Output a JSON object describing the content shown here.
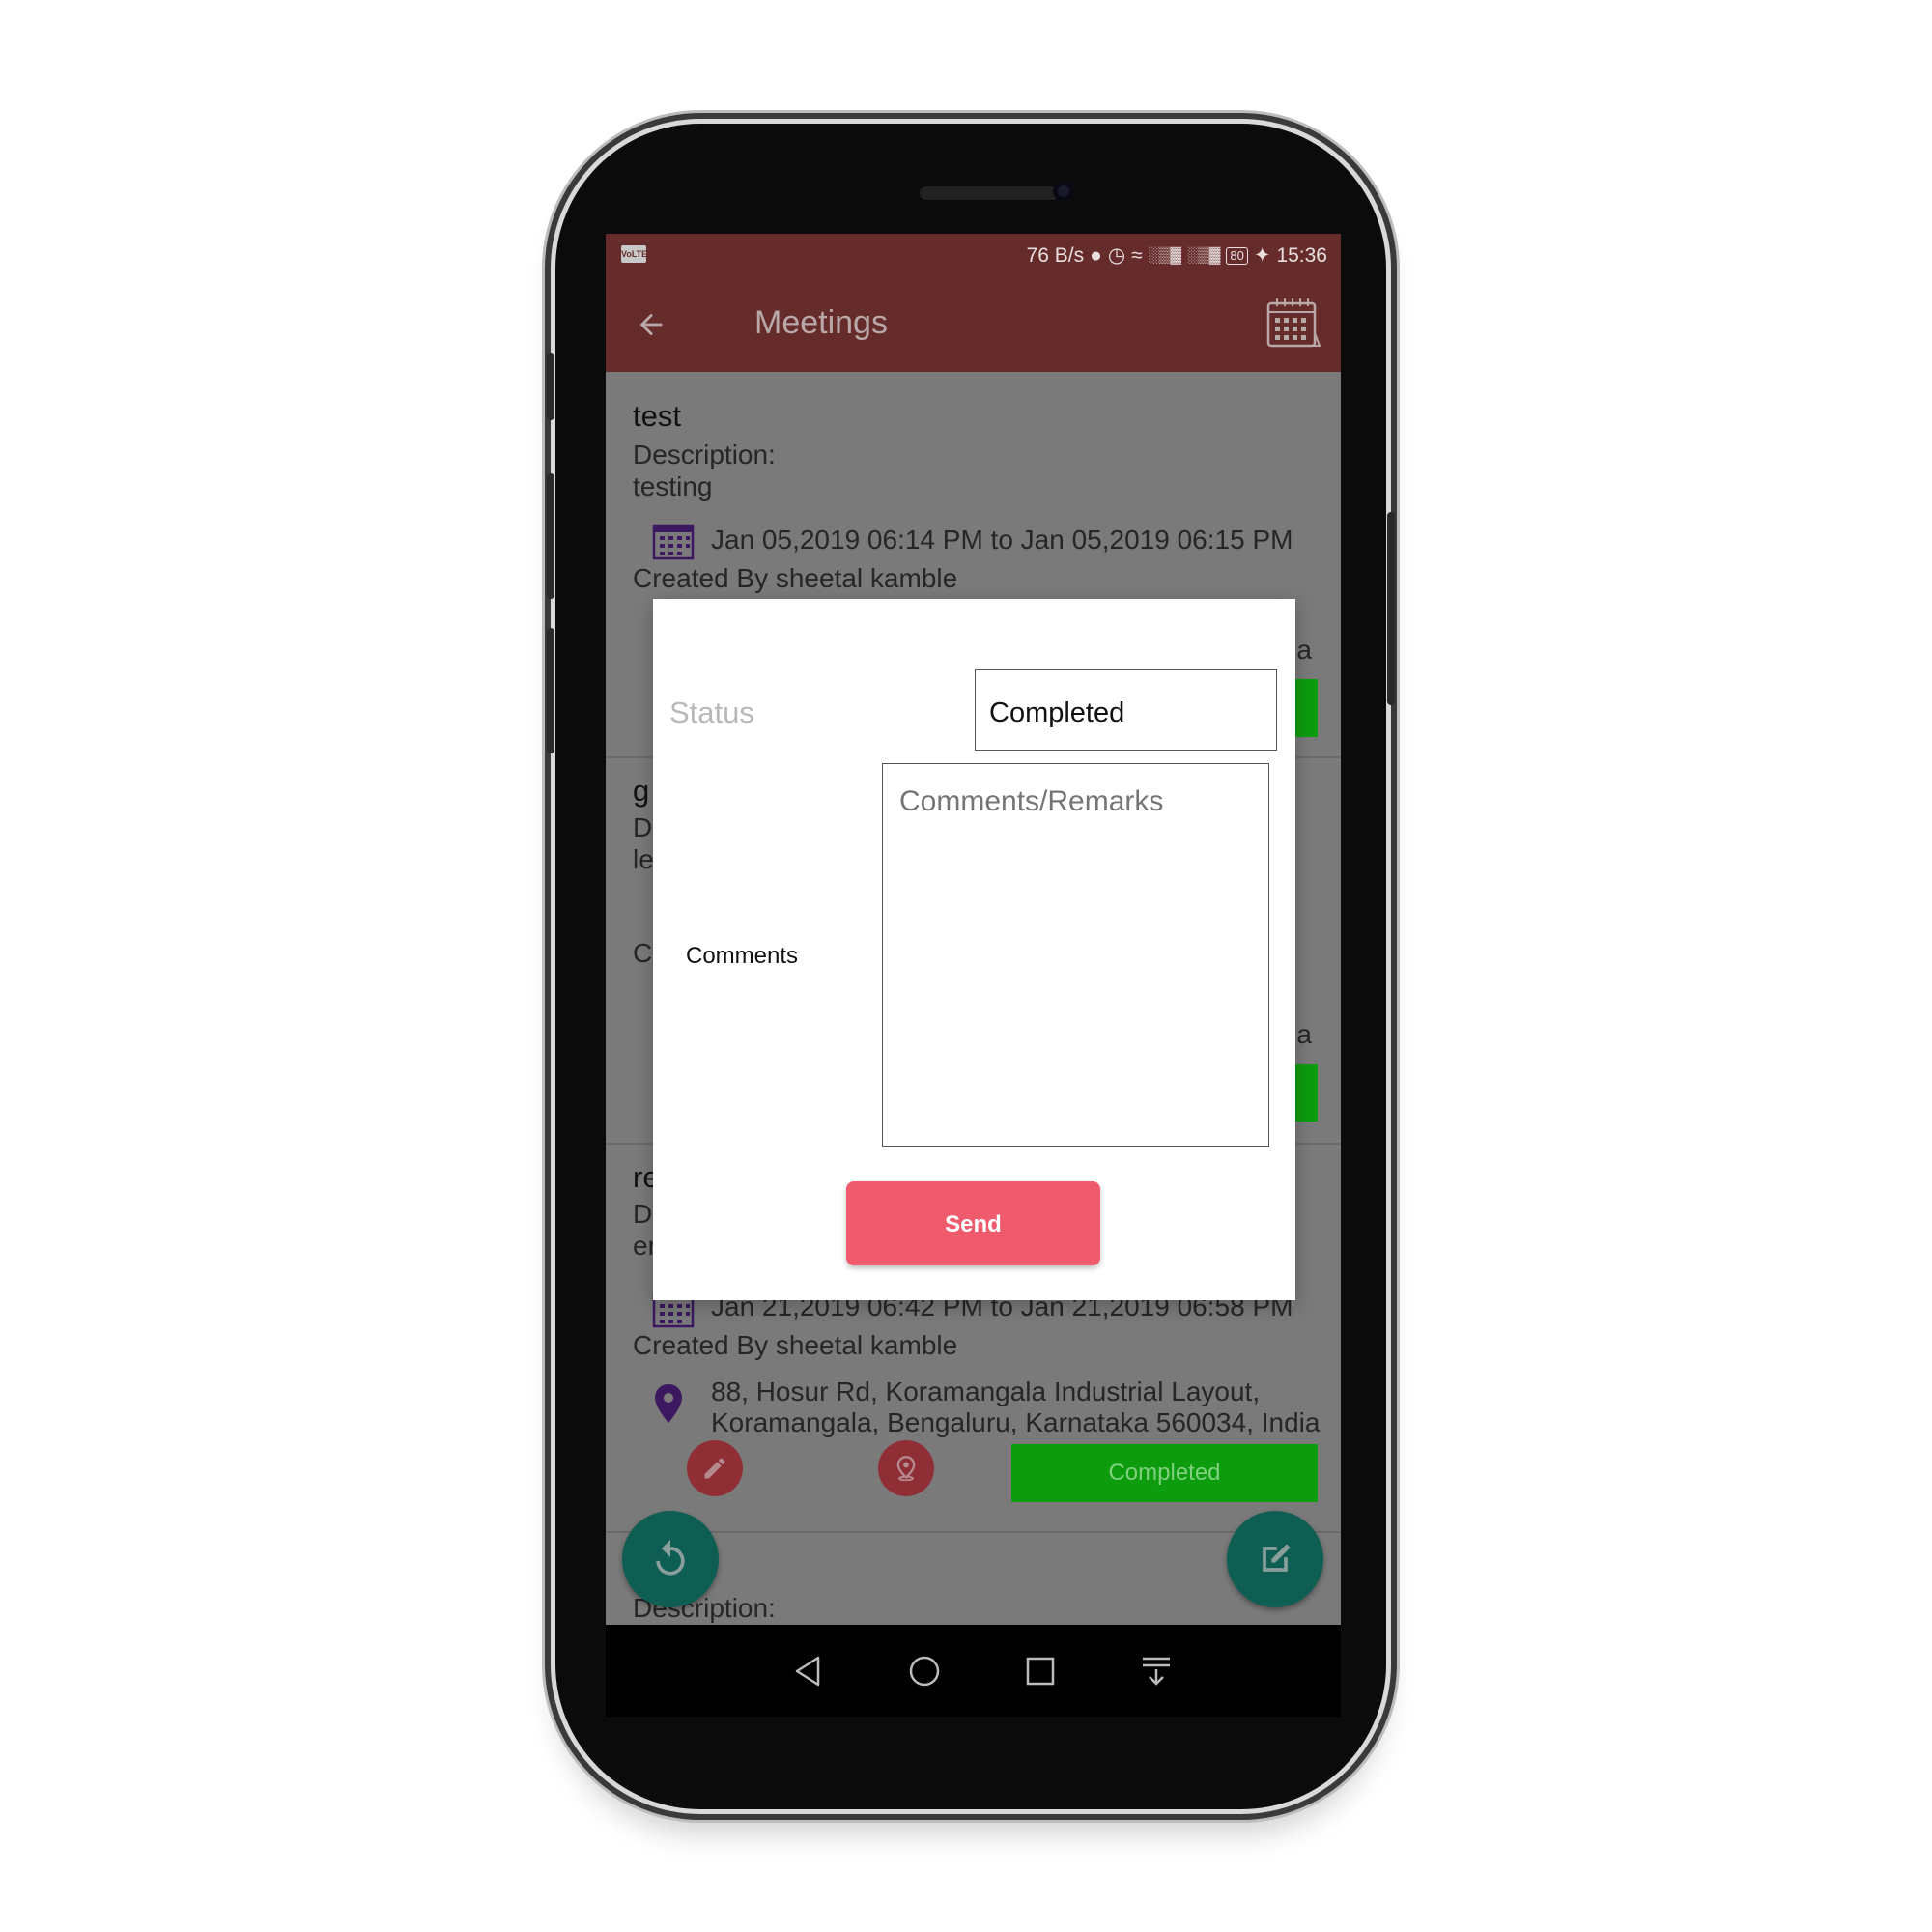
{
  "status_bar": {
    "volte": "VoLTE",
    "net_speed": "76 B/s",
    "battery": "80",
    "time": "15:36"
  },
  "app_bar": {
    "title": "Meetings",
    "back_icon": "arrow-left-icon",
    "calendar_icon": "calendar-icon"
  },
  "meetings": [
    {
      "title": "test",
      "description_label": "Description:",
      "description": "testing",
      "date_range": "Jan 05,2019 06:14 PM to Jan 05,2019 06:15 PM",
      "created_by": "Created By sheetal kamble",
      "address_partial": "a"
    },
    {
      "title_partial": "g",
      "description_partial": "D",
      "desc_value_partial": "le",
      "created_partial": "C",
      "address_partial": "a"
    },
    {
      "title_partial": "re",
      "description_partial": "D",
      "desc_value_partial": "er",
      "date_range": "Jan 21,2019 06:42 PM to Jan 21,2019 06:58 PM",
      "created_by": "Created By sheetal kamble",
      "address_line1": "88, Hosur Rd, Koramangala Industrial Layout,",
      "address_line2": "Koramangala, Bengaluru, Karnataka 560034, India",
      "status_button": "Completed"
    },
    {
      "description_label": "Description:"
    }
  ],
  "colors": {
    "app_bar": "#662b2b",
    "status_green": "#0d9c0d",
    "send_button": "#ef5a6d",
    "fab": "#0f5e54"
  },
  "dialog": {
    "status_label": "Status",
    "status_value": "Completed",
    "comments_label": "Comments",
    "comments_placeholder": "Comments/Remarks",
    "send_label": "Send"
  }
}
